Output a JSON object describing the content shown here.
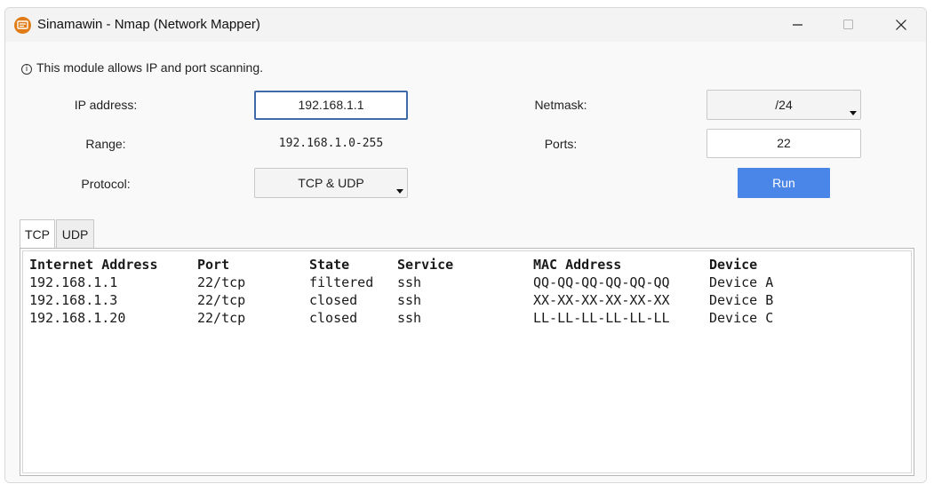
{
  "window": {
    "title": "Sinamawin - Nmap (Network Mapper)"
  },
  "info": {
    "icon": "info-icon",
    "text": "This module allows IP and port scanning."
  },
  "form": {
    "ip_label": "IP address:",
    "ip_value": "192.168.1.1",
    "netmask_label": "Netmask:",
    "netmask_value": "/24",
    "range_label": "Range:",
    "range_value": "192.168.1.0-255",
    "ports_label": "Ports:",
    "ports_value": "22",
    "protocol_label": "Protocol:",
    "protocol_value": "TCP & UDP",
    "run_label": "Run"
  },
  "tabs": [
    {
      "label": "TCP",
      "active": true
    },
    {
      "label": "UDP",
      "active": false
    }
  ],
  "table": {
    "headers": [
      "Internet Address",
      "Port",
      "State",
      "Service",
      "MAC Address",
      "Device"
    ],
    "rows": [
      [
        "192.168.1.1",
        "22/tcp",
        "filtered",
        "ssh",
        "QQ-QQ-QQ-QQ-QQ-QQ",
        "Device A"
      ],
      [
        "192.168.1.3",
        "22/tcp",
        "closed",
        "ssh",
        "XX-XX-XX-XX-XX-XX",
        "Device B"
      ],
      [
        "192.168.1.20",
        "22/tcp",
        "closed",
        "ssh",
        "LL-LL-LL-LL-LL-LL",
        "Device C"
      ]
    ]
  },
  "colors": {
    "accent": "#4a86e8",
    "app_icon": "#e07b15",
    "focus_border": "#3e6ba8"
  }
}
